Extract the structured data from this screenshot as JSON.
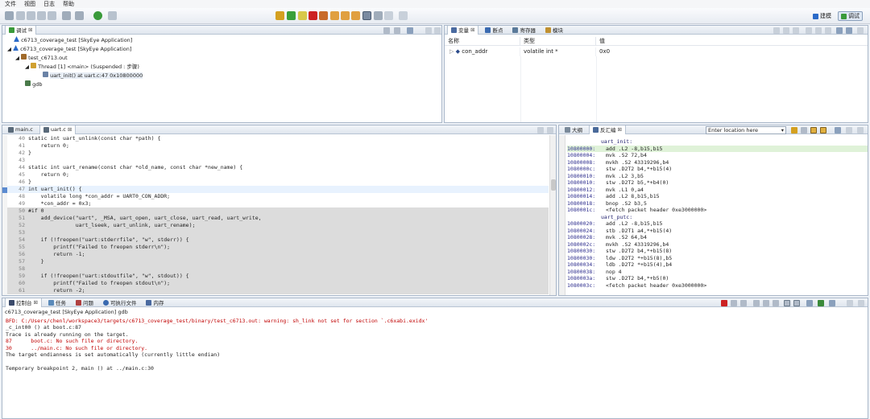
{
  "menu": [
    "文件",
    "视图",
    "日志",
    "帮助"
  ],
  "perspectives": {
    "build": "建模",
    "debug": "调试"
  },
  "debug_view": {
    "tab": "调试",
    "items": [
      "c6713_coverage_test [SkyEye Application]",
      "c6713_coverage_test [SkyEye Application]",
      "test_c6713.out",
      "Thread [1] <main> (Suspended : 步骤)",
      "uart_init() at uart.c:47 0x10800000",
      "gdb"
    ]
  },
  "variables_view": {
    "tabs": [
      "变量",
      "断点",
      "寄存器",
      "模块"
    ],
    "columns": [
      "名称",
      "类型",
      "值"
    ],
    "rows": [
      {
        "name": "con_addr",
        "type": "volatile int *",
        "value": "0x0"
      }
    ]
  },
  "editor": {
    "tabs": [
      "main.c",
      "uart.c"
    ],
    "lines": [
      {
        "n": "40",
        "t": "static int uart_unlink(const char *path) {",
        "s": ""
      },
      {
        "n": "41",
        "t": "    return 0;",
        "s": ""
      },
      {
        "n": "42",
        "t": "}",
        "s": ""
      },
      {
        "n": "43",
        "t": "",
        "s": ""
      },
      {
        "n": "44",
        "t": "static int uart_rename(const char *old_name, const char *new_name) {",
        "s": ""
      },
      {
        "n": "45",
        "t": "    return 0;",
        "s": ""
      },
      {
        "n": "46",
        "t": "}",
        "s": ""
      },
      {
        "n": "47",
        "t": "int uart_init() {",
        "s": "cur"
      },
      {
        "n": "48",
        "t": "    volatile long *con_addr = UART0_CON_ADDR;",
        "s": ""
      },
      {
        "n": "49",
        "t": "    *con_addr = 0x3;",
        "s": ""
      },
      {
        "n": "50",
        "t": "#if 0",
        "s": "grey"
      },
      {
        "n": "51",
        "t": "    add_device(\"uart\", _MSA, uart_open, uart_close, uart_read, uart_write,",
        "s": "grey"
      },
      {
        "n": "52",
        "t": "               uart_lseek, uart_unlink, uart_rename);",
        "s": "grey"
      },
      {
        "n": "53",
        "t": "",
        "s": "grey"
      },
      {
        "n": "54",
        "t": "    if (!freopen(\"uart:stderrfile\", \"w\", stderr)) {",
        "s": "grey"
      },
      {
        "n": "55",
        "t": "        printf(\"Failed to freopen stderr\\n\");",
        "s": "grey"
      },
      {
        "n": "56",
        "t": "        return -1;",
        "s": "grey"
      },
      {
        "n": "57",
        "t": "    }",
        "s": "grey"
      },
      {
        "n": "58",
        "t": "",
        "s": "grey"
      },
      {
        "n": "59",
        "t": "    if (!freopen(\"uart:stdoutfile\", \"w\", stdout)) {",
        "s": "grey"
      },
      {
        "n": "60",
        "t": "        printf(\"Failed to freopen stdout\\n\");",
        "s": "grey"
      },
      {
        "n": "61",
        "t": "        return -2;",
        "s": "grey"
      }
    ]
  },
  "disasm": {
    "tabs": [
      "大纲",
      "反汇编"
    ],
    "location_placeholder": "Enter location here",
    "lines": [
      {
        "a": "",
        "i": "uart_init:",
        "h": false,
        "lbl": true
      },
      {
        "a": "10800000:",
        "i": "add .L2 -8,b15,b15",
        "h": true,
        "lbl": false
      },
      {
        "a": "10800004:",
        "i": "mvk .S2 72,b4",
        "h": false,
        "lbl": false
      },
      {
        "a": "10800008:",
        "i": "mvkh .S2 43319296,b4",
        "h": false,
        "lbl": false
      },
      {
        "a": "1080000c:",
        "i": "stw .D2T2 b4,*+b15(4)",
        "h": false,
        "lbl": false
      },
      {
        "a": "10800010:",
        "i": "mvk .L2 3,b5",
        "h": false,
        "lbl": false
      },
      {
        "a": "10800010:",
        "i": "stw .D2T2 b5,*+b4(0)",
        "h": false,
        "lbl": false
      },
      {
        "a": "10800012:",
        "i": "mvk .L1 0,a4",
        "h": false,
        "lbl": false
      },
      {
        "a": "10800014:",
        "i": "add .L2 8,b15,b15",
        "h": false,
        "lbl": false
      },
      {
        "a": "10800018:",
        "i": "bnop .S2 b3,5",
        "h": false,
        "lbl": false
      },
      {
        "a": "1080001c:",
        "i": "<fetch packet header 0xe3000000>",
        "h": false,
        "lbl": false
      },
      {
        "a": "",
        "i": "uart_putc:",
        "h": false,
        "lbl": true
      },
      {
        "a": "10800020:",
        "i": "add .L2 -8,b15,b15",
        "h": false,
        "lbl": false
      },
      {
        "a": "10800024:",
        "i": "stb .D2T1 a4,*+b15(4)",
        "h": false,
        "lbl": false
      },
      {
        "a": "10800028:",
        "i": "mvk .S2 64,b4",
        "h": false,
        "lbl": false
      },
      {
        "a": "1080002c:",
        "i": "mvkh .S2 43319296,b4",
        "h": false,
        "lbl": false
      },
      {
        "a": "10800030:",
        "i": "stw .D2T2 b4,*+b15(8)",
        "h": false,
        "lbl": false
      },
      {
        "a": "10800030:",
        "i": "ldw .D2T2 *+b15(8),b5",
        "h": false,
        "lbl": false
      },
      {
        "a": "10800034:",
        "i": "ldb .D2T2 *+b15(4),b4",
        "h": false,
        "lbl": false
      },
      {
        "a": "10800038:",
        "i": "nop 4",
        "h": false,
        "lbl": false
      },
      {
        "a": "1080003a:",
        "i": "stw .D2T2 b4,*+b5(0)",
        "h": false,
        "lbl": false
      },
      {
        "a": "1080003c:",
        "i": "<fetch packet header 0xe3000000>",
        "h": false,
        "lbl": false
      }
    ]
  },
  "console": {
    "tabs": [
      "控制台",
      "任务",
      "问题",
      "可执行文件",
      "内存"
    ],
    "title": "c6713_coverage_test [SkyEye Application] gdb",
    "lines": [
      {
        "t": "BFD: C:/Users/chenl/workspace3/targets/c6713_coverage_test/binary/test_c6713.out: warning: sh_link not set for section `.c6xabi.exidx'",
        "c": "#c00000"
      },
      {
        "t": "_c_int00 () at boot.c:87",
        "c": "#222"
      },
      {
        "t": "Trace is already running on the target.",
        "c": "#222"
      },
      {
        "t": "87      boot.c: No such file or directory.",
        "c": "#c00000"
      },
      {
        "t": "30      ../main.c: No such file or directory.",
        "c": "#c00000"
      },
      {
        "t": "The target endianness is set automatically (currently little endian)",
        "c": "#222"
      },
      {
        "t": "",
        "c": "#222"
      },
      {
        "t": "Temporary breakpoint 2, main () at ../main.c:30",
        "c": "#222"
      }
    ]
  }
}
